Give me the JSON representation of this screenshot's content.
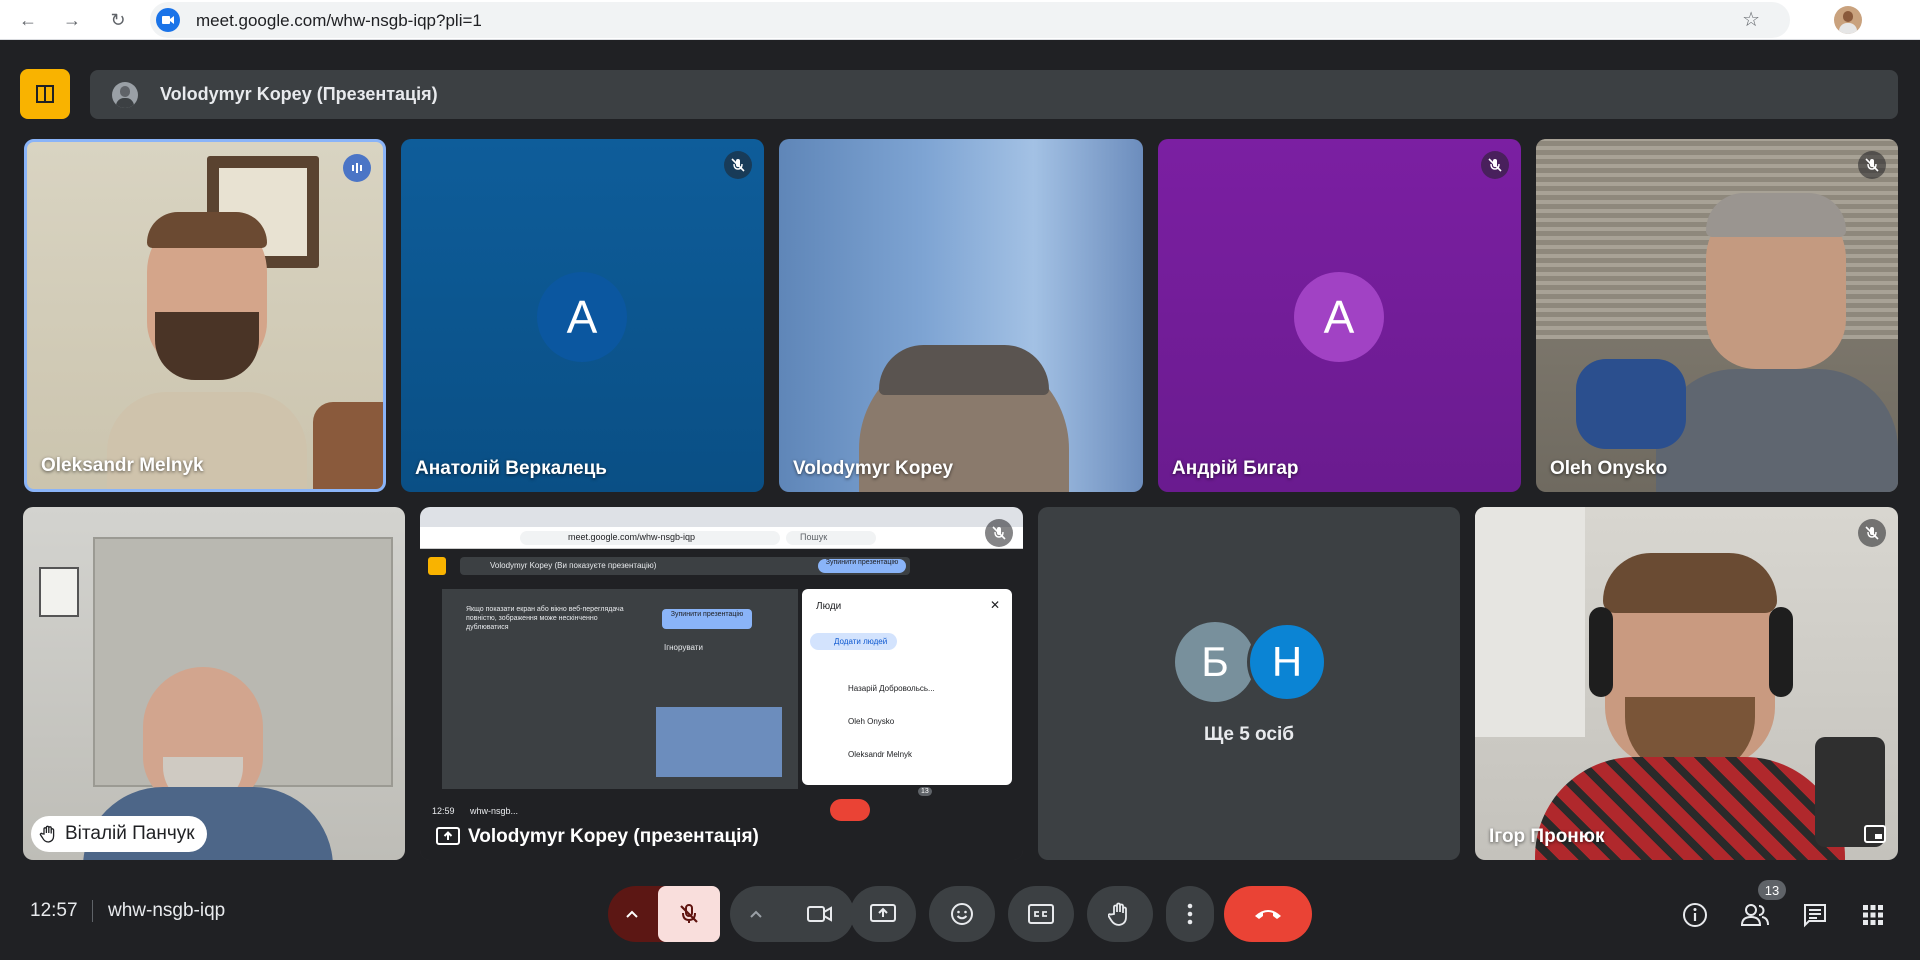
{
  "browser": {
    "url": "meet.google.com/whw-nsgb-iqp?pli=1"
  },
  "presentation": {
    "title": "Volodymyr Kopey (Презентація)"
  },
  "tiles": [
    {
      "name": "Oleksandr Melnyk",
      "type": "video",
      "status": "speaking"
    },
    {
      "name": "Анатолій Веркалець",
      "type": "avatar",
      "initial": "А",
      "status": "muted",
      "bg": "#1a5fa0",
      "avatar_color": "#0b57a0"
    },
    {
      "name": "Volodymyr Kopey",
      "type": "video",
      "status": ""
    },
    {
      "name": "Андрій Бигар",
      "type": "avatar",
      "initial": "А",
      "status": "muted",
      "bg": "#7b1fa2",
      "avatar_color": "#a142c4"
    },
    {
      "name": "Oleh Onysko",
      "type": "video",
      "status": "muted"
    },
    {
      "name": "Віталій Панчук",
      "type": "video",
      "status": "hand-raised"
    },
    {
      "name": "Volodymyr Kopey (презентація)",
      "type": "screen-share",
      "status": "muted"
    },
    {
      "name": "Ще 5 осіб",
      "type": "more",
      "initials": [
        "Б",
        "Н"
      ]
    },
    {
      "name": "Ігор Пронюк",
      "type": "video",
      "status": "muted"
    }
  ],
  "shared_screen": {
    "tab_title": "Volodymyr Kopey (Ви показуєте презентацію)",
    "stop_button": "Зупинити презентацію",
    "warning": "Якщо показати екран або вікно веб-переглядача повністю, зображення може нескінченно дублюватися",
    "stop_small": "Зупинити презентацію",
    "ignore": "Ігнорувати",
    "people_title": "Люди",
    "add_people": "Додати людей",
    "people": [
      "Назарій Добровольсь...",
      "Oleh Onysko",
      "Oleksandr Melnyk"
    ],
    "time": "12:59",
    "code": "whw-nsgb...",
    "badge": "13",
    "url": "meet.google.com/whw-nsgb-iqp",
    "search_placeholder": "Пошук"
  },
  "bottom": {
    "time": "12:57",
    "meeting_code": "whw-nsgb-iqp",
    "participants_count": "13"
  },
  "colors": {
    "background": "#202124",
    "end_call": "#ea4335",
    "mic_off": "#f9dedc",
    "mic_group": "#5c1714",
    "present_logo": "#f9b300"
  }
}
